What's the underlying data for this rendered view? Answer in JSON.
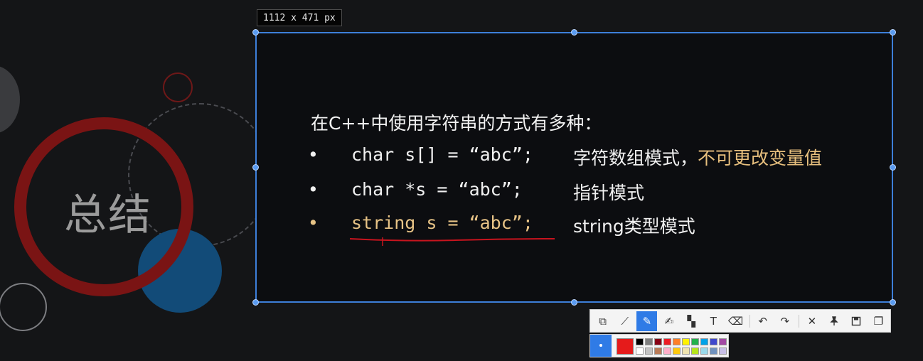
{
  "slide": {
    "summary_title": "总结",
    "heading": "在C++中使用字符串的方式有多种：",
    "bullets": [
      {
        "dot": "•",
        "code": "char s[] = “abc”;",
        "desc": "字符数组模式，",
        "warning": "不可更改变量值"
      },
      {
        "dot": "•",
        "code": "char *s = “abc”;",
        "desc": "指针模式",
        "warning": ""
      },
      {
        "dot": "•",
        "code": "string s = “abc”;",
        "desc": "string类型模式",
        "warning": ""
      }
    ]
  },
  "capture": {
    "size_label": "1112 x 471 px"
  },
  "toolbar": {
    "tools": [
      {
        "name": "rectangle-tool-icon",
        "glyph": "⧉"
      },
      {
        "name": "line-tool-icon",
        "glyph": "⟋"
      },
      {
        "name": "pen-tool-icon",
        "glyph": "✎"
      },
      {
        "name": "marker-tool-icon",
        "glyph": "✍"
      },
      {
        "name": "mosaic-tool-icon",
        "glyph": "▚"
      },
      {
        "name": "text-tool-icon",
        "glyph": "T"
      },
      {
        "name": "eraser-tool-icon",
        "glyph": "⌫"
      },
      {
        "name": "undo-icon",
        "glyph": "↶"
      },
      {
        "name": "redo-icon",
        "glyph": "↷"
      },
      {
        "name": "close-icon",
        "glyph": "✕"
      },
      {
        "name": "pin-icon",
        "glyph": "📌"
      },
      {
        "name": "save-icon",
        "glyph": "💾"
      },
      {
        "name": "copy-icon",
        "glyph": "❐"
      }
    ],
    "active_tool": "pen-tool-icon"
  },
  "palette": {
    "current": "#e51b1b",
    "swatches": [
      "#000000",
      "#7f7f7f",
      "#880015",
      "#ed1c24",
      "#ff7f27",
      "#fff200",
      "#22b14c",
      "#00a2e8",
      "#3f48cc",
      "#a349a4",
      "#ffffff",
      "#c3c3c3",
      "#b97a57",
      "#ffaec9",
      "#ffc90e",
      "#efe4b0",
      "#b5e61d",
      "#99d9ea",
      "#7092be",
      "#c8bfe7"
    ]
  }
}
